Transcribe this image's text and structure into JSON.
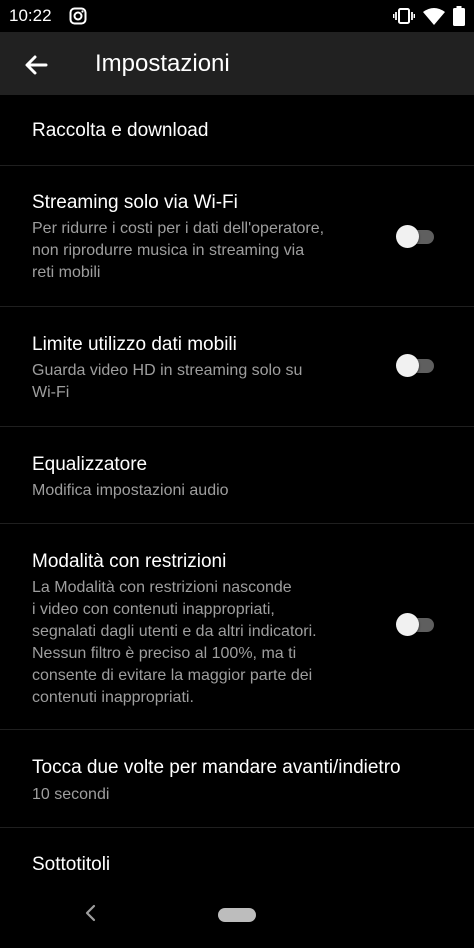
{
  "status": {
    "time": "10:22"
  },
  "header": {
    "title": "Impostazioni"
  },
  "settings": [
    {
      "title": "Raccolta e download"
    },
    {
      "title": "Streaming solo via Wi-Fi",
      "subtitle": "Per ridurre i costi per i dati dell'operatore,\nnon riprodurre musica in streaming via\nreti mobili",
      "toggle": false
    },
    {
      "title": "Limite utilizzo dati mobili",
      "subtitle": "Guarda video HD in streaming solo su\nWi-Fi",
      "toggle": false
    },
    {
      "title": "Equalizzatore",
      "subtitle": "Modifica impostazioni audio"
    },
    {
      "title": "Modalità con restrizioni",
      "subtitle": "La Modalità con restrizioni nasconde\ni video con contenuti inappropriati,\nsegnalati dagli utenti e da altri indicatori.\nNessun filtro è preciso al 100%, ma ti\nconsente di evitare la maggior parte dei\ncontenuti inappropriati.",
      "toggle": false
    },
    {
      "title": "Tocca due volte per mandare avanti/indietro",
      "subtitle": "10 secondi"
    },
    {
      "title": "Sottotitoli"
    }
  ],
  "colors": {
    "background": "#000000",
    "appbar": "#212121",
    "subtitle": "#9e9e9e"
  }
}
